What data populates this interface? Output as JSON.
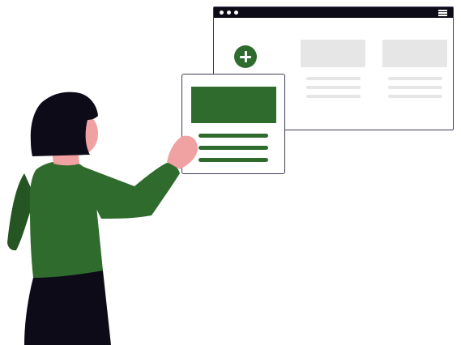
{
  "illustration": {
    "type": "flat vector illustration",
    "colors": {
      "accent": "#2f6b2d",
      "dark": "#0d0b18",
      "gray": "#e6e6e6",
      "skin": "#f0a1a2",
      "outline": "#3f3d56"
    },
    "icons": {
      "add": "plus-circle-icon",
      "menu": "hamburger-menu-icon"
    }
  }
}
